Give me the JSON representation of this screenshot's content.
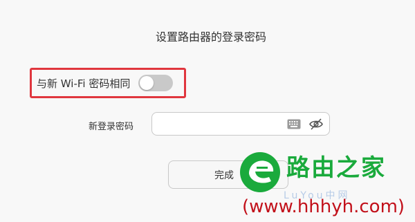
{
  "page": {
    "title": "设置路由器的登录密码"
  },
  "sync_option": {
    "label": "与新 Wi-Fi 密码相同",
    "toggle_on": false,
    "highlight_color": "#e0363e"
  },
  "password": {
    "label": "新登录密码",
    "value": "",
    "placeholder": "",
    "icons": [
      "keyboard-icon",
      "eye-hidden-icon"
    ]
  },
  "actions": {
    "done_label": "完成"
  },
  "watermark": {
    "brand": "路由之家",
    "url": "(www.hhhyh.com)",
    "faint_text": "LuYou中网",
    "brand_color": "#1aaa3c",
    "url_color": "#c2101a"
  }
}
